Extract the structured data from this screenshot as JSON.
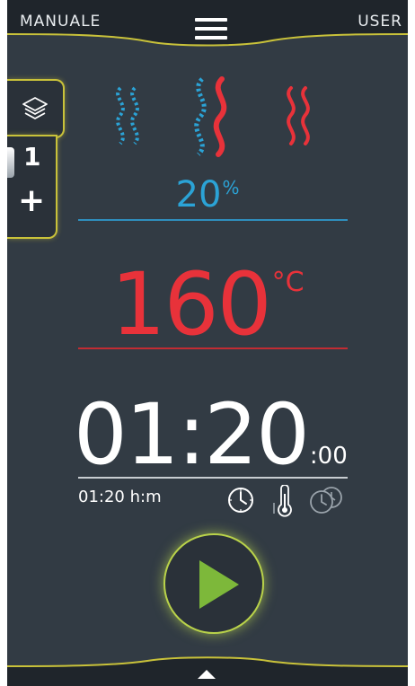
{
  "header": {
    "mode_label": "MANUALE",
    "user_label": "USER",
    "menu_icon": "hamburger-menu-icon"
  },
  "sidebar": {
    "layers_icon": "layers-icon",
    "step_number": "1",
    "add_label": "+"
  },
  "cooking_modes": [
    {
      "name": "steam",
      "icon": "steam-wave-icon",
      "color": "#2ba3d6"
    },
    {
      "name": "combi",
      "icon": "combi-wave-icon",
      "color": "#e8323a"
    },
    {
      "name": "convection",
      "icon": "hot-air-wave-icon",
      "color": "#e8323a"
    }
  ],
  "humidity": {
    "value": "20",
    "unit": "%"
  },
  "temperature": {
    "value": "160",
    "unit": "°C"
  },
  "timer": {
    "main": "01:20",
    "seconds": ":00",
    "sub_label": "01:20 h:m",
    "icons": [
      "clock-icon",
      "core-probe-thermometer-icon",
      "delayed-start-clock-icon"
    ]
  },
  "start_button": {
    "icon": "play-icon"
  },
  "footer": {
    "icon": "chevron-up-icon"
  },
  "colors": {
    "background": "#323b44",
    "bar": "#1f252b",
    "accent_border": "#c9c23a",
    "humidity": "#2ba3d6",
    "temperature": "#e8323a",
    "play": "#7db83a"
  }
}
